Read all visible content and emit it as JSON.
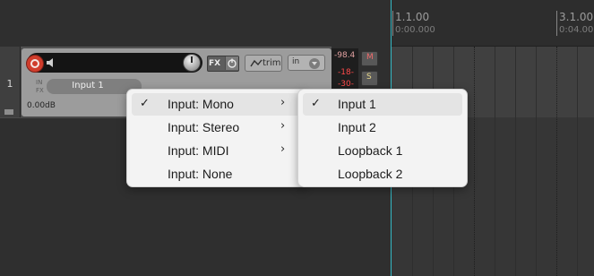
{
  "track": {
    "number": "1",
    "input_selector_label": "Input 1",
    "volume_label": "0.00dB",
    "infx_in": "IN",
    "infx_fx": "FX",
    "fx_button_label": "FX",
    "trim_button_label": "trim",
    "in_button_label": "in",
    "peak_readout": "-98.4",
    "peak_markers": [
      "-18-",
      "-30-"
    ],
    "mute_label": "M",
    "solo_label": "S"
  },
  "ruler": {
    "markers": [
      {
        "bar": "1.1.00",
        "time": "0:00.000"
      },
      {
        "bar": "3.1.00",
        "time": "0:04.00"
      }
    ]
  },
  "input_menu": {
    "items": [
      {
        "label": "Input: Mono",
        "checked": true,
        "submenu": true
      },
      {
        "label": "Input: Stereo",
        "checked": false,
        "submenu": true
      },
      {
        "label": "Input: MIDI",
        "checked": false,
        "submenu": true
      },
      {
        "label": "Input: None",
        "checked": false,
        "submenu": false
      }
    ]
  },
  "mono_submenu": {
    "items": [
      {
        "label": "Input 1",
        "checked": true
      },
      {
        "label": "Input 2",
        "checked": false
      },
      {
        "label": "Loopback 1",
        "checked": false
      },
      {
        "label": "Loopback 2",
        "checked": false
      }
    ]
  },
  "glyphs": {
    "check": "✓",
    "submenu_arrow": "›"
  },
  "colors": {
    "record_arm": "#d03d2c",
    "playhead": "#34b9c5",
    "menu_bg": "#f3f3f3",
    "menu_highlight": "#e4e4e4"
  }
}
